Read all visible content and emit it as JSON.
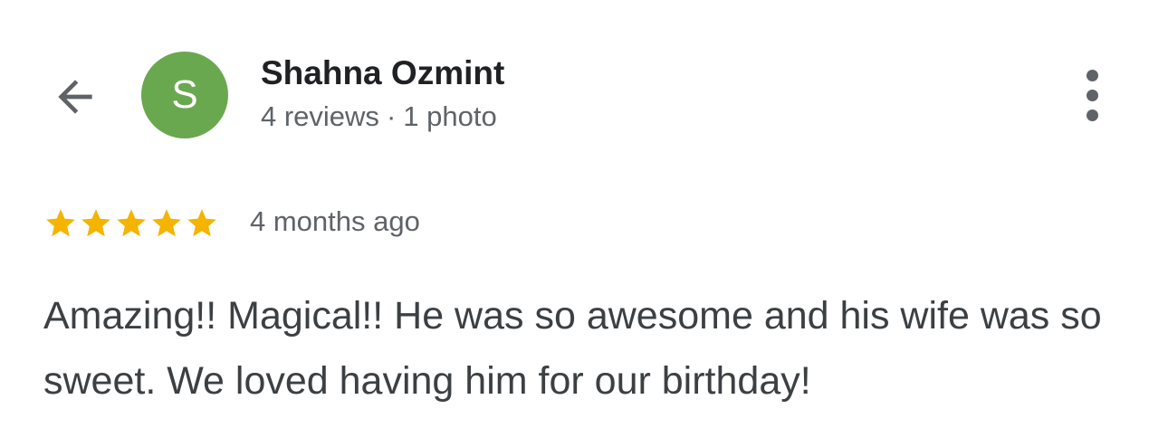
{
  "header": {
    "back_icon": "arrow-back-icon",
    "more_icon": "more-vert-icon",
    "icon_color": "#5f6368"
  },
  "reviewer": {
    "initial": "S",
    "avatar_color": "#6aa84f",
    "name": "Shahna Ozmint",
    "reviews": "4 reviews",
    "separator": "·",
    "photos": "1 photo"
  },
  "review": {
    "rating": 5,
    "rating_max": 5,
    "star_color": "#f4b400",
    "time": "4 months ago",
    "text": "Amazing!! Magical!! He was so awesome and his wife was so sweet. We loved having him for our birthday!"
  }
}
